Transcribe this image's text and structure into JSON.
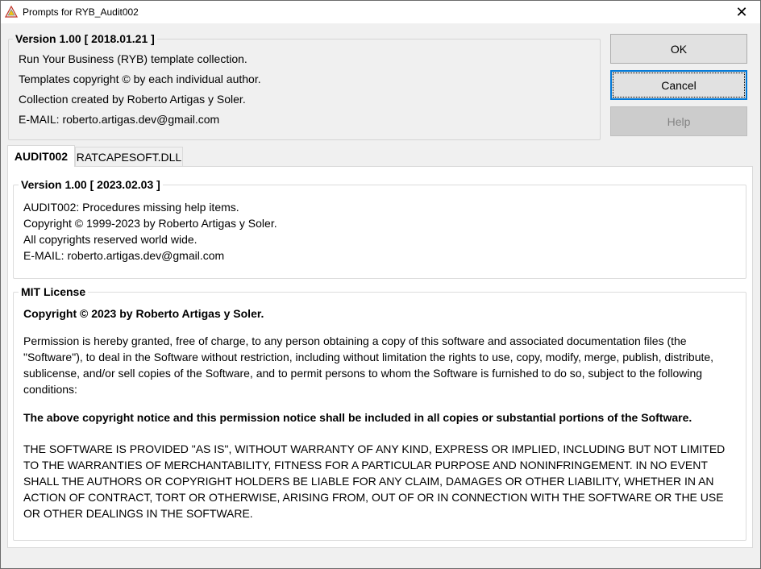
{
  "window": {
    "title": "Prompts for RYB_Audit002",
    "close_glyph": "✕"
  },
  "collection_group": {
    "legend": "Version 1.00 [ 2018.01.21 ]",
    "lines": [
      "Run Your Business (RYB) template collection.",
      "Templates copyright © by each individual author.",
      "Collection created by Roberto Artigas y Soler.",
      "E-MAIL: roberto.artigas.dev@gmail.com"
    ]
  },
  "buttons": {
    "ok": "OK",
    "cancel": "Cancel",
    "help": "Help"
  },
  "tabs": [
    {
      "label": "AUDIT002",
      "active": true
    },
    {
      "label": "RATCAPESOFT.DLL",
      "active": false
    }
  ],
  "audit_group": {
    "legend": "Version 1.00 [ 2023.02.03 ]",
    "lines": [
      "AUDIT002: Procedures missing help items.",
      "Copyright © 1999-2023 by Roberto Artigas y Soler.",
      "All copyrights reserved world wide.",
      "E-MAIL: roberto.artigas.dev@gmail.com"
    ]
  },
  "license_group": {
    "legend": "MIT License",
    "copyright": "Copyright © 2023 by Roberto Artigas y Soler.",
    "permission": "Permission is hereby granted, free of charge, to any person obtaining a copy of this software and associated documentation files (the \"Software\"), to deal in the Software without restriction, including without limitation the rights to use, copy, modify, merge, publish, distribute, sublicense, and/or sell copies of the Software, and to permit persons to whom the Software is furnished to do so, subject to the following conditions:",
    "notice": "The above copyright notice and this permission notice shall be included in all copies or substantial portions of the Software.",
    "warranty": "THE SOFTWARE IS PROVIDED \"AS IS\", WITHOUT WARRANTY OF ANY KIND, EXPRESS OR IMPLIED, INCLUDING BUT NOT LIMITED TO THE WARRANTIES OF MERCHANTABILITY, FITNESS FOR A PARTICULAR PURPOSE AND NONINFRINGEMENT. IN NO EVENT SHALL THE AUTHORS OR COPYRIGHT HOLDERS BE LIABLE FOR ANY CLAIM, DAMAGES OR OTHER LIABILITY, WHETHER IN AN ACTION OF CONTRACT, TORT OR OTHERWISE, ARISING FROM, OUT OF OR IN CONNECTION WITH THE SOFTWARE OR THE USE OR OTHER DEALINGS IN THE SOFTWARE."
  },
  "icons": {
    "app": "triangle-warning-icon",
    "close": "close-icon"
  },
  "colors": {
    "focus_border": "#0078d7",
    "disabled_text": "#838383",
    "app_icon_stroke": "#c0392b"
  }
}
